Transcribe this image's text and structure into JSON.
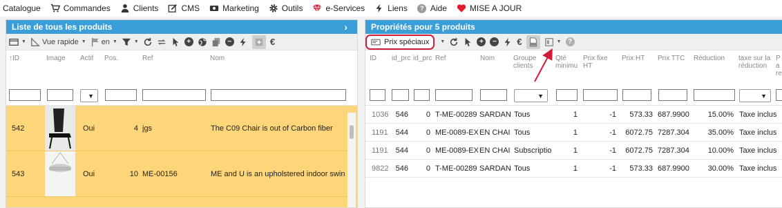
{
  "menu": {
    "catalogue": "Catalogue",
    "commandes": "Commandes",
    "clients": "Clients",
    "cms": "CMS",
    "marketing": "Marketing",
    "outils": "Outils",
    "eservices": "e-Services",
    "liens": "Liens",
    "aide": "Aide",
    "maj": "MISE A JOUR",
    "aide_icon": "?"
  },
  "left": {
    "title": "Liste de tous les produits",
    "toolbar": {
      "vue_rapide": "Vue rapide",
      "lang": "en",
      "euro": "€"
    },
    "columns": {
      "id": "ID",
      "image": "Image",
      "actif": "Actif",
      "pos": "Pos.",
      "ref": "Ref",
      "nom": "Nom"
    },
    "rows": [
      {
        "id": "542",
        "actif": "Oui",
        "pos": "4",
        "ref": "jgs",
        "nom": "The C09 Chair is out of Carbon fiber"
      },
      {
        "id": "543",
        "actif": "Oui",
        "pos": "10",
        "ref": "ME-00156",
        "nom": "ME and U is an upholstered indoor swin"
      }
    ]
  },
  "right": {
    "title": "Propriétés pour 5 produits",
    "toolbar": {
      "prix_speciaux": "Prix spéciaux",
      "euro": "€"
    },
    "columns": {
      "id": "ID",
      "id_prc1": "id_prc",
      "id_prc2": "id_prc",
      "ref": "Ref",
      "nom": "Nom",
      "groupe_l1": "Groupe",
      "groupe_l2": "clients",
      "qte_l1": "Qté",
      "qte_l2": "minimu",
      "pfht_l1": "Prix fixe",
      "pfht_l2": "HT",
      "prix_ht": "Prix HT",
      "prix_ttc": "Prix TTC",
      "reduction": "Réduction",
      "taxe_l1": "taxe sur la",
      "taxe_l2": "réduction",
      "p_l1": "P",
      "p_l2": "a",
      "p_l3": "re"
    },
    "rows": [
      {
        "id": "1036",
        "c1": "546",
        "c2": "0",
        "ref": "T-ME-00289",
        "nom": "SARDAN",
        "groupe": "Tous",
        "qte": "1",
        "pfht": "-1",
        "prix_ht": "573.33",
        "prix_ttc": "687.9900",
        "reduction": "15.00%",
        "taxe": "Taxe inclus"
      },
      {
        "id": "1191",
        "c1": "544",
        "c2": "0",
        "ref": "ME-0089-EX",
        "nom": "EN CHAI",
        "groupe": "Tous",
        "qte": "1",
        "pfht": "-1",
        "prix_ht": "6072.75",
        "prix_ttc": "7287.304",
        "reduction": "35.00%",
        "taxe": "Taxe inclus"
      },
      {
        "id": "1191",
        "c1": "544",
        "c2": "0",
        "ref": "ME-0089-EX",
        "nom": "EN CHAI",
        "groupe": "Subscriptio",
        "qte": "1",
        "pfht": "-1",
        "prix_ht": "6072.75",
        "prix_ttc": "7287.304",
        "reduction": "10.00%",
        "taxe": "Taxe inclus"
      },
      {
        "id": "9822",
        "c1": "546",
        "c2": "0",
        "ref": "T-ME-00289",
        "nom": "SARDAN",
        "groupe": "Tous",
        "qte": "1",
        "pfht": "-1",
        "prix_ht": "573.33",
        "prix_ttc": "687.9900",
        "reduction": "30.00%",
        "taxe": "Taxe inclus"
      }
    ]
  },
  "colors": {
    "header_blue": "#3a9fd9",
    "row_highlight": "#fdd67a",
    "prix_button_border": "#d21c3c",
    "arrow": "#d21c3c"
  },
  "icons": [
    "cart-icon",
    "user-icon",
    "cms-icon",
    "marketing-icon",
    "gear-icon",
    "diamond-icon",
    "bolt-icon",
    "help-icon",
    "heart-icon",
    "arrow-up-icon"
  ]
}
